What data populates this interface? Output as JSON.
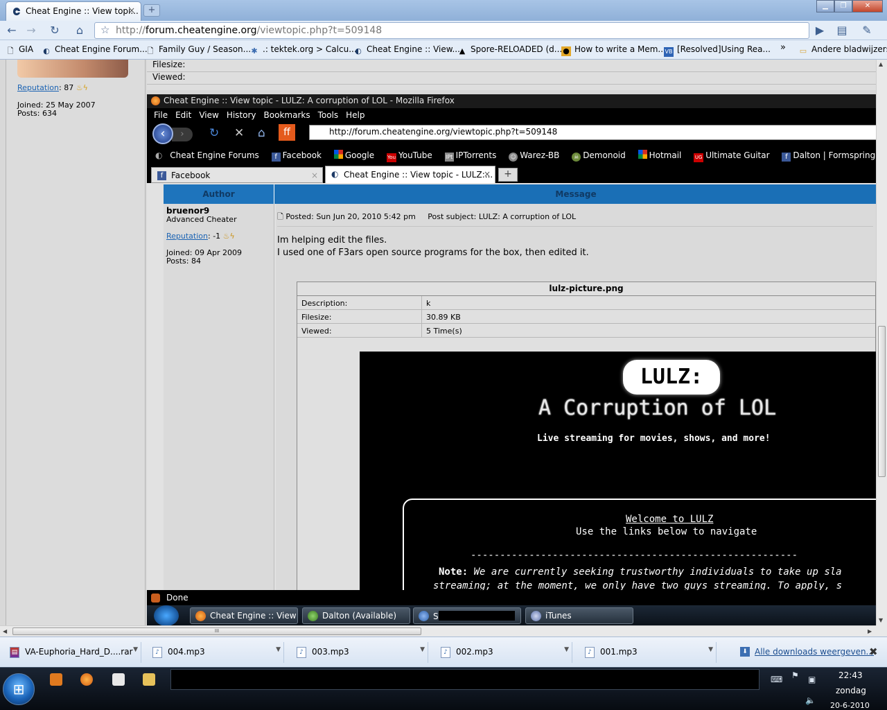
{
  "chrome": {
    "tab_title": "Cheat Engine :: View topi...",
    "tab_close": "×",
    "new_tab": "+",
    "url_prefix": "http://",
    "url_domain": "forum.cheatengine.org",
    "url_path": "/viewtopic.php?t=509148",
    "bookmarks": [
      {
        "label": "GIA",
        "icon": "page-icon"
      },
      {
        "label": "Cheat Engine Forum...",
        "icon": "cheat-engine-icon"
      },
      {
        "label": "Family Guy / Season...",
        "icon": "page-icon"
      },
      {
        "label": ".: tektek.org > Calcu...",
        "icon": "tektek-icon"
      },
      {
        "label": "Cheat Engine :: View...",
        "icon": "cheat-engine-icon"
      },
      {
        "label": "Spore-RELOADED (d...",
        "icon": "spore-icon"
      },
      {
        "label": "How to write a Mem...",
        "icon": "game-icon"
      },
      {
        "label": "[Resolved]Using Rea...",
        "icon": "vb-icon"
      }
    ],
    "bookmarks_more": "»",
    "other_bookmarks": "Andere bladwijzers"
  },
  "page": {
    "reputation_label": "Reputation",
    "reputation_value": ": 87",
    "joined": "Joined: 25 May 2007",
    "posts": "Posts: 634",
    "filesize_label": "Filesize:",
    "viewed_label": "Viewed:"
  },
  "firefox": {
    "title": "Cheat Engine :: View topic - LULZ: A corruption of LOL - Mozilla Firefox",
    "menu": [
      "File",
      "Edit",
      "View",
      "History",
      "Bookmarks",
      "Tools",
      "Help"
    ],
    "url": "http://forum.cheatengine.org/viewtopic.php?t=509148",
    "bookmarks": [
      {
        "label": "Cheat Engine Forums",
        "icon": "cheat-engine-icon"
      },
      {
        "label": "Facebook",
        "icon": "facebook-icon"
      },
      {
        "label": "Google",
        "icon": "google-icon"
      },
      {
        "label": "YouTube",
        "icon": "youtube-icon"
      },
      {
        "label": "IPTorrents",
        "icon": "iptorrents-icon"
      },
      {
        "label": "Warez-BB",
        "icon": "warez-icon"
      },
      {
        "label": "Demonoid",
        "icon": "demonoid-icon"
      },
      {
        "label": "Hotmail",
        "icon": "windows-icon"
      },
      {
        "label": "Ultimate Guitar",
        "icon": "guitar-icon"
      },
      {
        "label": "Dalton | Formspring.Me",
        "icon": "facebook-icon"
      }
    ],
    "tabs": [
      {
        "label": "Facebook"
      },
      {
        "label": "Cheat Engine :: View topic - LULZ:..."
      }
    ],
    "tab_close": "×",
    "new_tab": "+",
    "status": "Done"
  },
  "post": {
    "author_header": "Author",
    "message_header": "Message",
    "author": "bruenor9",
    "rank": "Advanced Cheater",
    "reputation_label": "Reputation",
    "reputation_value": ": -1",
    "joined": "Joined: 09 Apr 2009",
    "posts": "Posts: 84",
    "posted": "Posted: Sun Jun 20, 2010 5:42 pm",
    "subject": "Post subject: LULZ: A corruption of LOL",
    "body_line1": "Im helping edit the files.",
    "body_line2": "I used one of F3ars open source programs for the box, then edited it."
  },
  "attachment": {
    "filename": "lulz-picture.png",
    "description_label": "Description:",
    "description_value": "k",
    "filesize_label": "Filesize:",
    "filesize_value": "30.89 KB",
    "viewed_label": "Viewed:",
    "viewed_value": "5 Time(s)"
  },
  "lulz_image": {
    "logo": "LULZ:",
    "subtitle": "A Corruption of LOL",
    "tagline": "Live streaming for movies, shows, and more!",
    "welcome": "Welcome to LULZ",
    "use_links": "Use the links below to navigate",
    "dashes": "--------------------------------------------------------",
    "note_label": "Note:",
    "note_text": "We are currently seeking trustworthy individuals to take up sla",
    "note_text2": "streaming; at the moment, we only have two guys streaming. To apply, s"
  },
  "inner_taskbar": [
    {
      "label": "Cheat Engine :: View ..."
    },
    {
      "label": "Dalton (Available)"
    },
    {
      "label": "S"
    },
    {
      "label": "iTunes"
    }
  ],
  "downloads": [
    {
      "label": "VA-Euphoria_Hard_D....rar"
    },
    {
      "label": "004.mp3"
    },
    {
      "label": "003.mp3"
    },
    {
      "label": "002.mp3"
    },
    {
      "label": "001.mp3"
    }
  ],
  "downloads_all": "Alle downloads weergeven...",
  "downloads_close": "✖",
  "scroll_grip": "III",
  "clock": {
    "time": "22:43",
    "day": "zondag",
    "date": "20-6-2010"
  },
  "colors": {
    "forum_header": "#1a6fb6",
    "chrome_frame": "#a8c4e6"
  }
}
